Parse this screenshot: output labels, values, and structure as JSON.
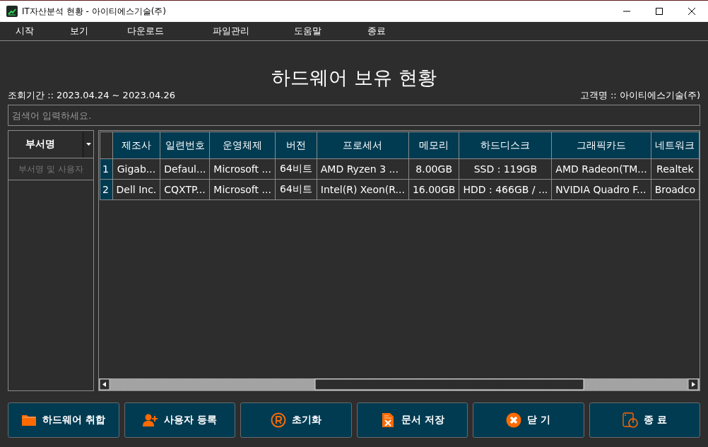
{
  "window": {
    "title": "IT자산분석 현황 - 아이티에스기술(주)"
  },
  "menu": [
    "시작",
    "보기",
    "다운로드",
    "파일관리",
    "도움말",
    "종료"
  ],
  "heading": "하드웨어 보유 현황",
  "period": "조회기간 :: 2023.04.24 ~ 2023.04.26",
  "customer": "고객명 :: 아이티에스기술(주)",
  "search": {
    "placeholder": "검색어 입력하세요."
  },
  "dept_panel": {
    "header": "부서명",
    "placeholder": "부서명 및 사용자"
  },
  "table": {
    "columns": [
      "제조사",
      "일련번호",
      "운영체제",
      "버전",
      "프로세서",
      "메모리",
      "하드디스크",
      "그래픽카드",
      "네트워크"
    ],
    "rows": [
      {
        "index": "1",
        "cells": [
          "Gigab...",
          "Defaul...",
          "Microsoft ...",
          "64비트",
          "AMD Ryzen 3 ...",
          "8.00GB",
          "SSD : 119GB",
          "AMD Radeon(TM...",
          "Realtek"
        ]
      },
      {
        "index": "2",
        "cells": [
          "Dell Inc.",
          "CQXTP...",
          "Microsoft ...",
          "64비트",
          "Intel(R) Xeon(R...",
          "16.00GB",
          "HDD : 466GB / ...",
          "NVIDIA Quadro F...",
          "Broadco"
        ]
      }
    ]
  },
  "buttons": [
    {
      "kind": "folder",
      "label": "하드웨어 취합"
    },
    {
      "kind": "user-add",
      "label": "사용자 등록"
    },
    {
      "kind": "reset",
      "label": "초기화"
    },
    {
      "kind": "excel",
      "label": "문서 저장"
    },
    {
      "kind": "close",
      "label": "닫 기"
    },
    {
      "kind": "power",
      "label": "종 료"
    }
  ]
}
